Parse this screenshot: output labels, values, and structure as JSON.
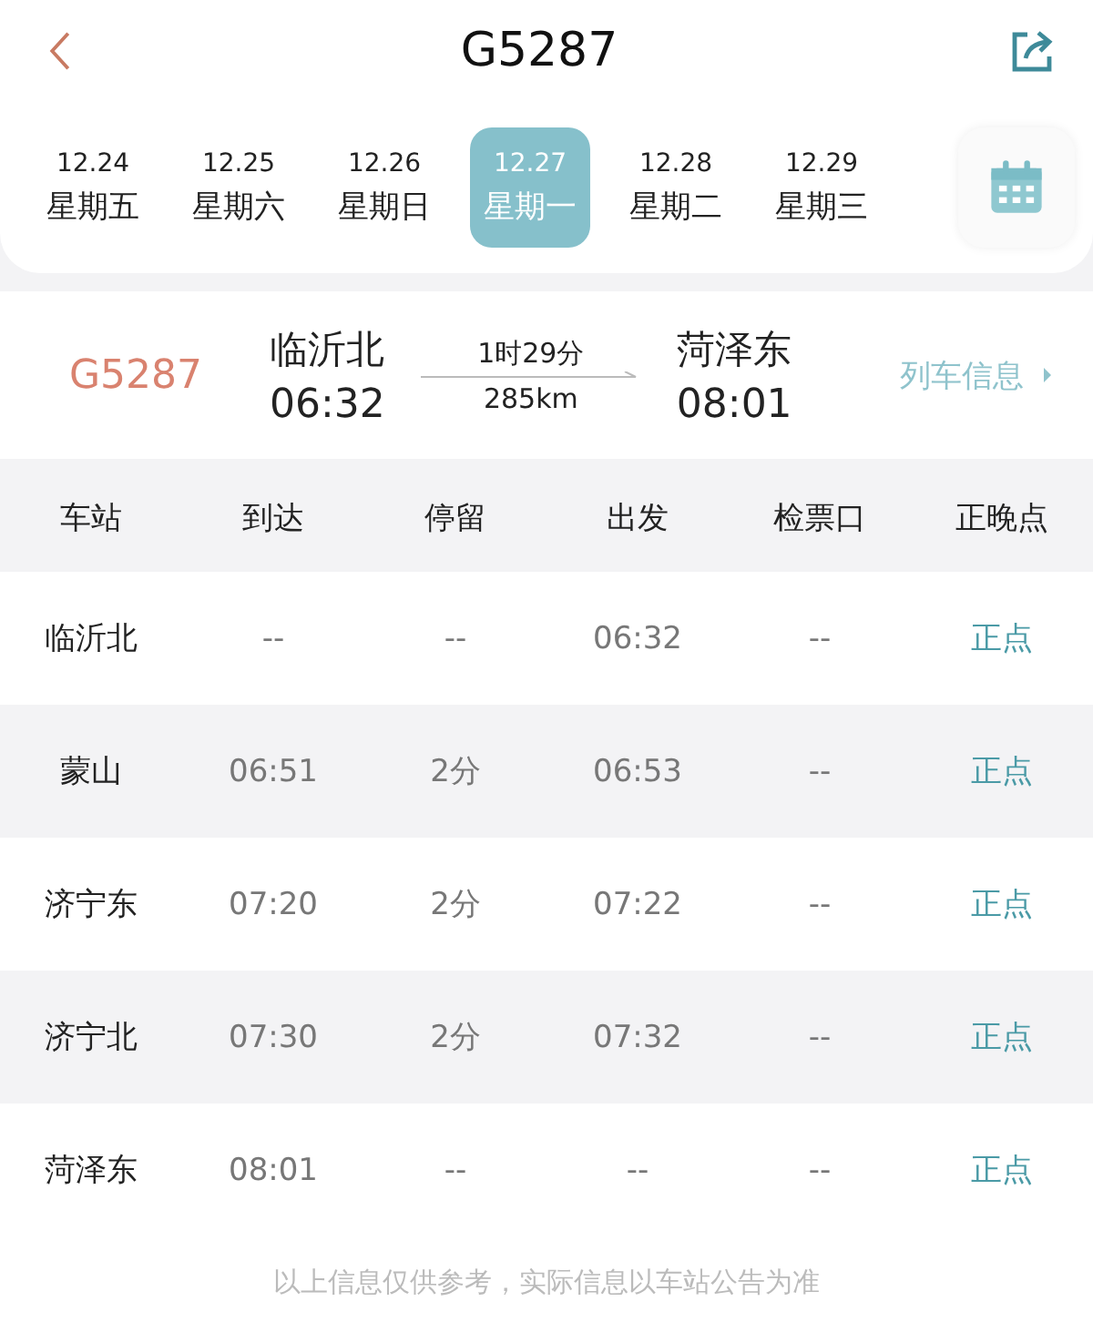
{
  "header": {
    "title": "G5287"
  },
  "dates": [
    {
      "date": "12.24",
      "weekday": "星期五",
      "selected": false
    },
    {
      "date": "12.25",
      "weekday": "星期六",
      "selected": false
    },
    {
      "date": "12.26",
      "weekday": "星期日",
      "selected": false
    },
    {
      "date": "12.27",
      "weekday": "星期一",
      "selected": true
    },
    {
      "date": "12.28",
      "weekday": "星期二",
      "selected": false
    },
    {
      "date": "12.29",
      "weekday": "星期三",
      "selected": false
    }
  ],
  "summary": {
    "train": "G5287",
    "from_station": "临沂北",
    "from_time": "06:32",
    "duration": "1时29分",
    "distance": "285km",
    "to_station": "菏泽东",
    "to_time": "08:01",
    "info_link": "列车信息"
  },
  "table": {
    "columns": [
      "车站",
      "到达",
      "停留",
      "出发",
      "检票口",
      "正晚点"
    ],
    "rows": [
      [
        "临沂北",
        "--",
        "--",
        "06:32",
        "--",
        "正点"
      ],
      [
        "蒙山",
        "06:51",
        "2分",
        "06:53",
        "--",
        "正点"
      ],
      [
        "济宁东",
        "07:20",
        "2分",
        "07:22",
        "--",
        "正点"
      ],
      [
        "济宁北",
        "07:30",
        "2分",
        "07:32",
        "--",
        "正点"
      ],
      [
        "菏泽东",
        "08:01",
        "--",
        "--",
        "--",
        "正点"
      ]
    ]
  },
  "footer": "以上信息仅供参考，实际信息以车站公告为准"
}
